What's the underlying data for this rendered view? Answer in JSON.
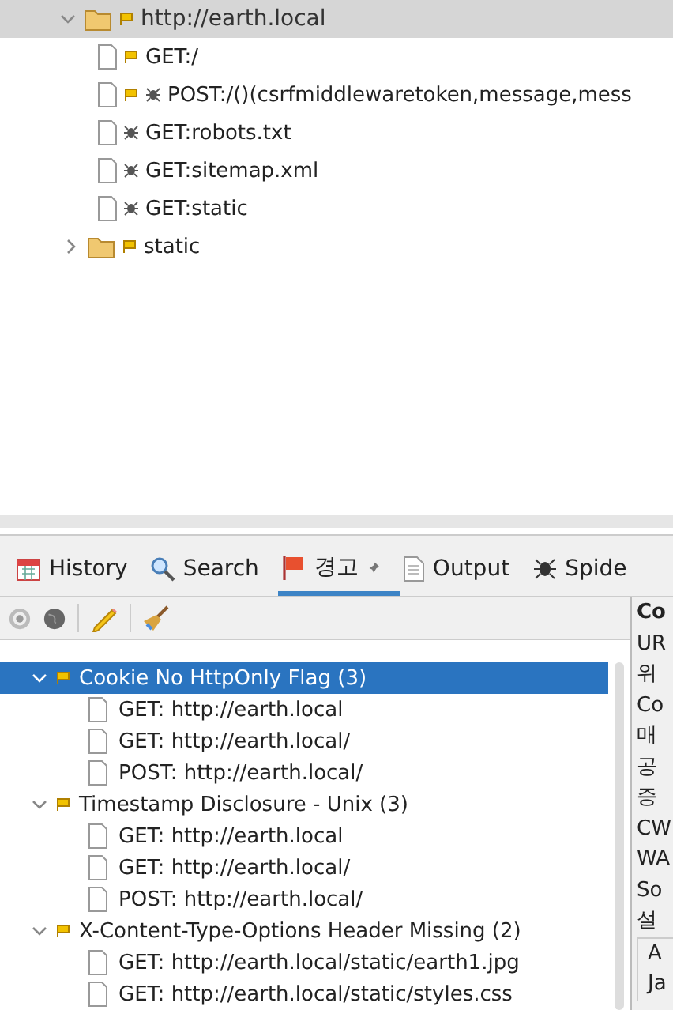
{
  "sites_tree": {
    "root": {
      "label": "http://earth.local",
      "expanded": true,
      "selected": true,
      "flag": true,
      "children": [
        {
          "kind": "page",
          "label": "GET:/",
          "flag": true,
          "spider": false
        },
        {
          "kind": "page",
          "label": "POST:/()(csrfmiddlewaretoken,message,mess",
          "flag": true,
          "spider": true
        },
        {
          "kind": "page",
          "label": "GET:robots.txt",
          "flag": false,
          "spider": true
        },
        {
          "kind": "page",
          "label": "GET:sitemap.xml",
          "flag": false,
          "spider": true
        },
        {
          "kind": "page",
          "label": "GET:static",
          "flag": false,
          "spider": true
        },
        {
          "kind": "folder",
          "label": "static",
          "flag": true,
          "spider": false,
          "expanded": false
        }
      ]
    }
  },
  "tabs": [
    {
      "kind": "history",
      "label": "History",
      "selected": false,
      "pinned": false
    },
    {
      "kind": "search",
      "label": "Search",
      "selected": false,
      "pinned": false
    },
    {
      "kind": "alerts",
      "label": "경고",
      "selected": true,
      "pinned": true
    },
    {
      "kind": "output",
      "label": "Output",
      "selected": false,
      "pinned": false
    },
    {
      "kind": "spider",
      "label": "Spide",
      "selected": false,
      "pinned": false
    }
  ],
  "alerts": [
    {
      "label": "Cookie No HttpOnly Flag (3)",
      "expanded": true,
      "selected": true,
      "children": [
        {
          "label": "GET: http://earth.local"
        },
        {
          "label": "GET: http://earth.local/"
        },
        {
          "label": "POST: http://earth.local/"
        }
      ]
    },
    {
      "label": "Timestamp Disclosure - Unix (3)",
      "expanded": true,
      "selected": false,
      "children": [
        {
          "label": "GET: http://earth.local"
        },
        {
          "label": "GET: http://earth.local/"
        },
        {
          "label": "POST: http://earth.local/"
        }
      ]
    },
    {
      "label": "X-Content-Type-Options Header Missing (2)",
      "expanded": true,
      "selected": false,
      "children": [
        {
          "label": "GET: http://earth.local/static/earth1.jpg"
        },
        {
          "label": "GET: http://earth.local/static/styles.css"
        }
      ]
    }
  ],
  "details": {
    "title": "Co",
    "lines": [
      "UR",
      "위",
      "Co",
      "매",
      "공",
      "증",
      "CW",
      "WA",
      "So"
    ],
    "section": "설",
    "section_lines": [
      "A",
      "Ja"
    ]
  }
}
